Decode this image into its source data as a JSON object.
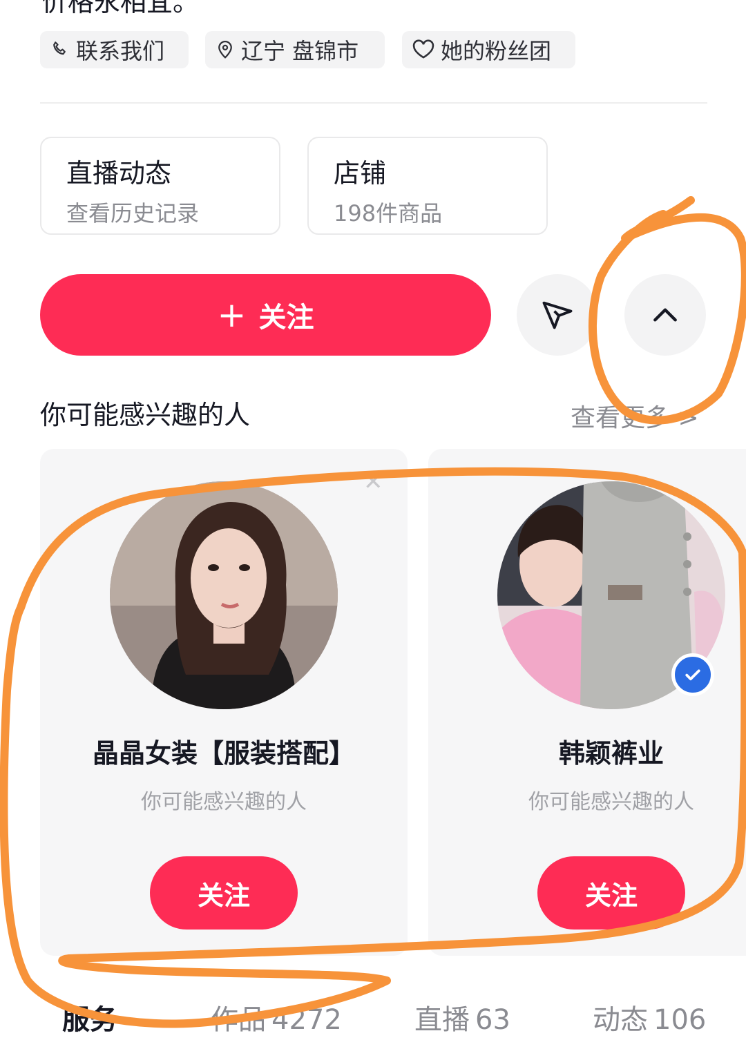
{
  "top_text": "价格永相宜。",
  "tags": [
    {
      "label": "联系我们",
      "icon": "phone-icon"
    },
    {
      "label": "辽宁 盘锦市",
      "icon": "location-pin-icon"
    },
    {
      "label": "她的粉丝团",
      "icon": "heart-icon"
    }
  ],
  "entries": [
    {
      "title": "直播动态",
      "sub": "查看历史记录"
    },
    {
      "title": "店铺",
      "sub": "198件商品"
    }
  ],
  "actions": {
    "follow_plus": "+",
    "follow_label": "关注",
    "share_icon": "send-icon",
    "collapse_icon": "chevron-up-icon"
  },
  "recommend": {
    "title": "你可能感兴趣的人",
    "see_more": "查看更多 >",
    "cards": [
      {
        "name": "晶晶女装【服装搭配】",
        "sub": "你可能感兴趣的人",
        "follow": "关注",
        "verified": false
      },
      {
        "name": "韩颖裤业",
        "sub": "你可能感兴趣的人",
        "follow": "关注",
        "verified": true
      }
    ]
  },
  "tabs": [
    {
      "label": "服务",
      "count": ""
    },
    {
      "label": "作品",
      "count": "4272"
    },
    {
      "label": "直播",
      "count": "63"
    },
    {
      "label": "动态",
      "count": "106"
    }
  ],
  "colors": {
    "accent": "#fe2c55",
    "annotation": "#f7933a",
    "verified": "#2b6ce3"
  }
}
